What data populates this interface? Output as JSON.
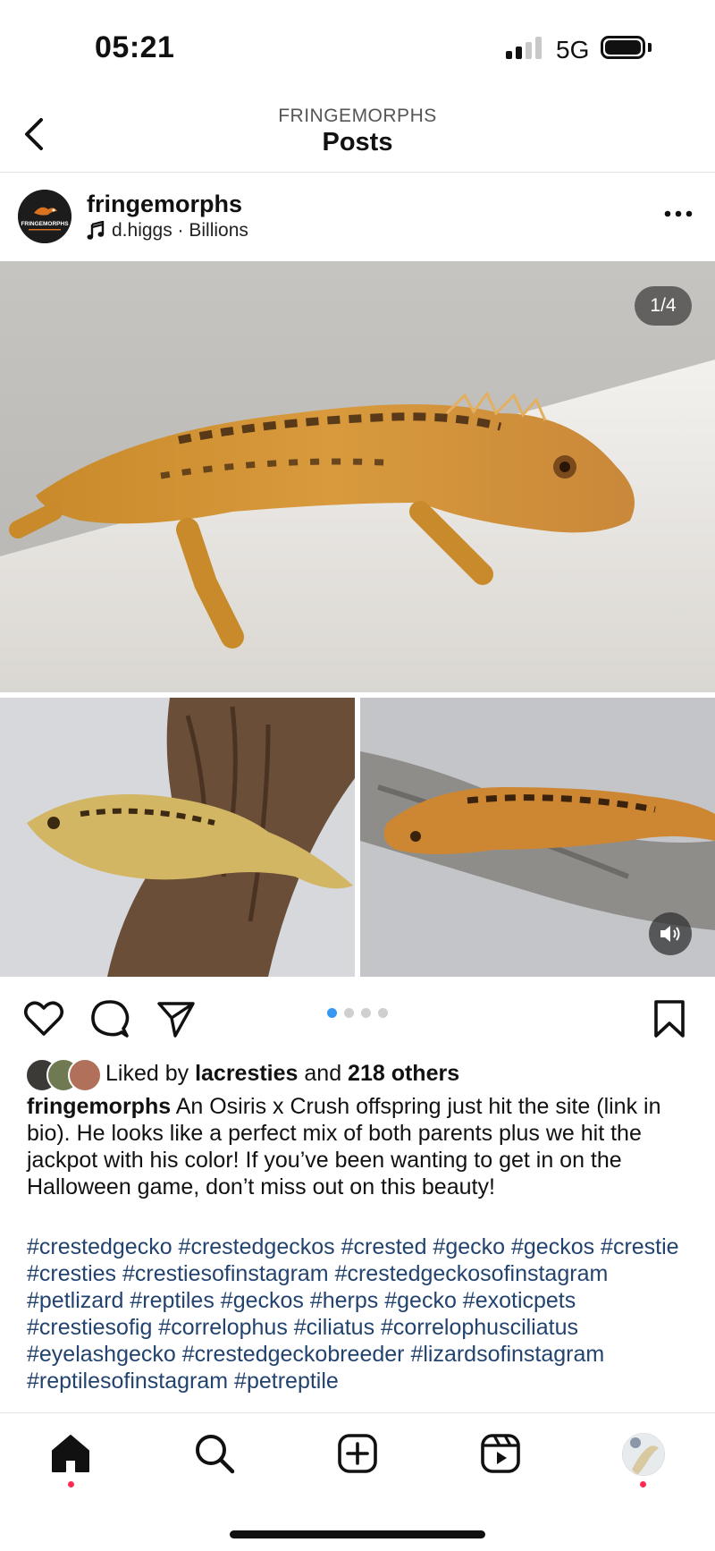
{
  "status_bar": {
    "time": "05:21",
    "network": "5G",
    "battery_level": 1.0
  },
  "header": {
    "account_label": "FRINGEMORPHS",
    "title": "Posts",
    "back_icon": "chevron-left-icon"
  },
  "post": {
    "username": "fringemorphs",
    "avatar_text": "FRINGEMORPHS",
    "music_icon": "music-note-icon",
    "audio": "d.higgs · Billions",
    "more_icon": "more-horizontal-icon",
    "media_counter": "1/4",
    "media_count": 4,
    "media_active_index": 0,
    "sound_icon": "speaker-icon",
    "actions": {
      "like_icon": "heart-icon",
      "comment_icon": "comment-icon",
      "share_icon": "send-icon",
      "save_icon": "bookmark-icon"
    },
    "likes": {
      "prefix": "Liked by ",
      "user": "lacresties",
      "middle": " and ",
      "others": "218 others"
    },
    "caption": {
      "author": "fringemorphs",
      "text": " An Osiris x Crush offspring just hit the site (link in bio). He looks like a perfect mix of both parents plus we hit the jackpot with his color! If you’ve been wanting to get in on the Halloween game, don’t miss out on this beauty!"
    },
    "hashtags": "#crestedgecko #crestedgeckos #crested  #gecko #geckos #crestie #cresties #crestiesofinstagram #crestedgeckosofinstagram #petlizard #reptiles #geckos #herps #gecko #exoticpets #crestiesofig #correlophus #ciliatus #correlophusciliatus #eyelashgecko #crestedgeckobreeder #lizardsofinstagram #reptilesofinstagram #petreptile",
    "colors": {
      "hashtag": "#23436f",
      "active_dot": "#3897f0",
      "notification_dot": "#ff2d55"
    }
  },
  "bottom_nav": {
    "items": [
      "home-icon",
      "search-icon",
      "create-icon",
      "reels-icon",
      "profile-avatar"
    ]
  }
}
